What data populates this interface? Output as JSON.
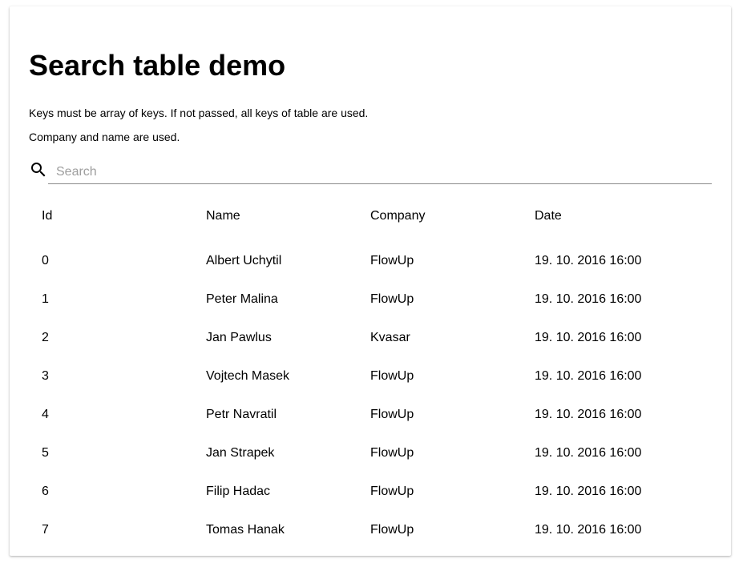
{
  "page": {
    "title": "Search table demo",
    "description_line1": "Keys must be array of keys. If not passed, all keys of table are used.",
    "description_line2": "Company and name are used."
  },
  "search": {
    "placeholder": "Search",
    "value": "",
    "icon": "search-icon"
  },
  "table": {
    "headers": [
      "Id",
      "Name",
      "Company",
      "Date"
    ],
    "rows": [
      [
        "0",
        "Albert Uchytil",
        "FlowUp",
        "19. 10. 2016 16:00"
      ],
      [
        "1",
        "Peter Malina",
        "FlowUp",
        "19. 10. 2016 16:00"
      ],
      [
        "2",
        "Jan Pawlus",
        "Kvasar",
        "19. 10. 2016 16:00"
      ],
      [
        "3",
        "Vojtech Masek",
        "FlowUp",
        "19. 10. 2016 16:00"
      ],
      [
        "4",
        "Petr Navratil",
        "FlowUp",
        "19. 10. 2016 16:00"
      ],
      [
        "5",
        "Jan Strapek",
        "FlowUp",
        "19. 10. 2016 16:00"
      ],
      [
        "6",
        "Filip Hadac",
        "FlowUp",
        "19. 10. 2016 16:00"
      ],
      [
        "7",
        "Tomas Hanak",
        "FlowUp",
        "19. 10. 2016 16:00"
      ]
    ]
  }
}
